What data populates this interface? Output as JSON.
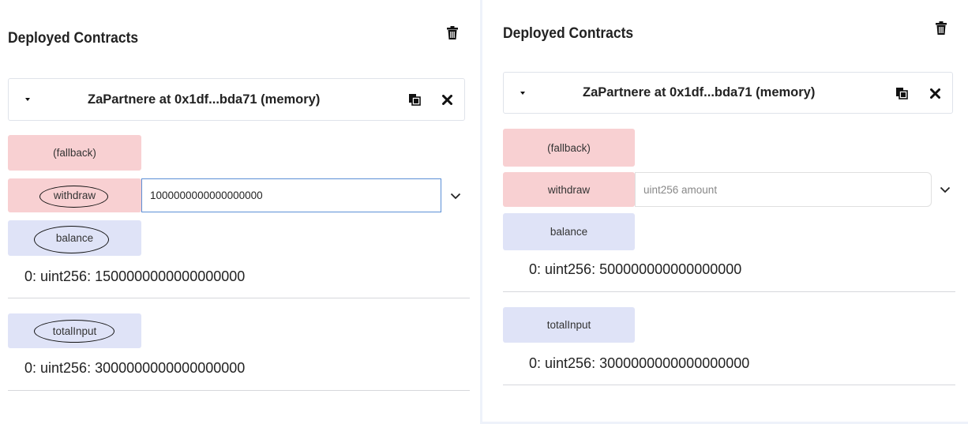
{
  "left": {
    "title": "Deployed Contracts",
    "instance_title": "ZaPartnere at 0x1df...bda71 (memory)",
    "fallback_label": "(fallback)",
    "withdraw_label": "withdraw",
    "withdraw_value": "1000000000000000000",
    "balance_label": "balance",
    "balance_result": "0: uint256: 1500000000000000000",
    "totalinput_label": "totalInput",
    "totalinput_result": "0: uint256: 3000000000000000000"
  },
  "right": {
    "title": "Deployed Contracts",
    "instance_title": "ZaPartnere at 0x1df...bda71 (memory)",
    "fallback_label": "(fallback)",
    "withdraw_label": "withdraw",
    "withdraw_placeholder": "uint256 amount",
    "balance_label": "balance",
    "balance_result": "0: uint256: 500000000000000000",
    "totalinput_label": "totalInput",
    "totalinput_result": "0: uint256: 3000000000000000000"
  },
  "icons": {
    "trash": "trash-icon",
    "caret": "caret-down-icon",
    "copy": "copy-icon",
    "close": "close-icon",
    "chevron": "chevron-down-icon"
  },
  "colors": {
    "payable_button": "#f8d0d2",
    "call_button": "#dfe3f7",
    "input_focus_border": "#5b8fd6"
  }
}
